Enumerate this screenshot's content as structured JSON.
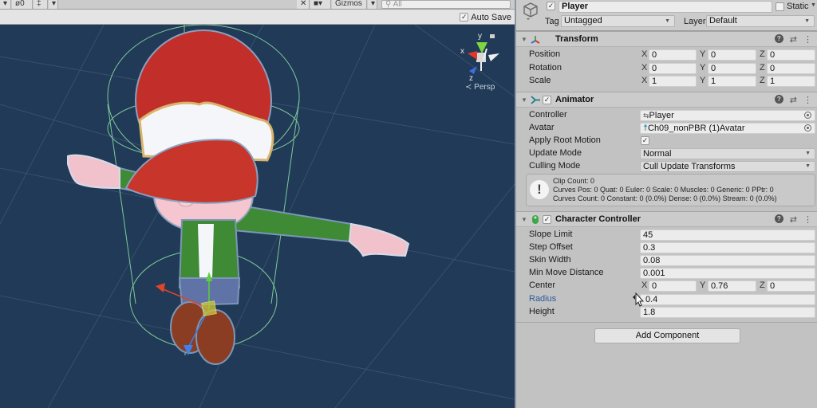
{
  "scene": {
    "toolbar": {
      "visibility_count": "0",
      "layers_icon": "grid-icon",
      "tools_icon": "wrench-icon",
      "gizmos_label": "Gizmos",
      "search_placeholder": "All"
    },
    "auto_save": {
      "label": "Auto Save",
      "checked": true
    },
    "gizmo": {
      "x": "x",
      "y": "y",
      "z": "z",
      "projection": "Persp"
    }
  },
  "inspector": {
    "game_object": {
      "name": "Player",
      "active": true,
      "static_label": "Static",
      "static": false,
      "tag_label": "Tag",
      "tag": "Untagged",
      "layer_label": "Layer",
      "layer": "Default"
    },
    "transform": {
      "title": "Transform",
      "rows": [
        {
          "label": "Position",
          "x": "0",
          "y": "0",
          "z": "0"
        },
        {
          "label": "Rotation",
          "x": "0",
          "y": "0",
          "z": "0"
        },
        {
          "label": "Scale",
          "x": "1",
          "y": "1",
          "z": "1"
        }
      ]
    },
    "animator": {
      "title": "Animator",
      "enabled": true,
      "controller_label": "Controller",
      "controller": "Player",
      "avatar_label": "Avatar",
      "avatar": "Ch09_nonPBR (1)Avatar",
      "apply_root_motion_label": "Apply Root Motion",
      "apply_root_motion": true,
      "update_mode_label": "Update Mode",
      "update_mode": "Normal",
      "culling_mode_label": "Culling Mode",
      "culling_mode": "Cull Update Transforms",
      "info": [
        "Clip Count: 0",
        "Curves Pos: 0 Quat: 0 Euler: 0 Scale: 0 Muscles: 0 Generic: 0 PPtr: 0",
        "Curves Count: 0 Constant: 0 (0.0%) Dense: 0 (0.0%) Stream: 0 (0.0%)"
      ]
    },
    "character_controller": {
      "title": "Character Controller",
      "enabled": true,
      "slope_limit_label": "Slope Limit",
      "slope_limit": "45",
      "step_offset_label": "Step Offset",
      "step_offset": "0.3",
      "skin_width_label": "Skin Width",
      "skin_width": "0.08",
      "min_move_distance_label": "Min Move Distance",
      "min_move_distance": "0.001",
      "center_label": "Center",
      "center": {
        "x": "0",
        "y": "0.76",
        "z": "0"
      },
      "radius_label": "Radius",
      "radius": "0.4",
      "height_label": "Height",
      "height": "1.8"
    },
    "add_component_label": "Add Component",
    "vector_labels": {
      "x": "X",
      "y": "Y",
      "z": "Z"
    },
    "colors": {
      "panel_bg": "#c2c2c2",
      "header_bg": "#cbcbcb",
      "field_bg": "#ececec",
      "hover_label": "#2c5a9a",
      "viewport_bg": "#213a57"
    }
  }
}
